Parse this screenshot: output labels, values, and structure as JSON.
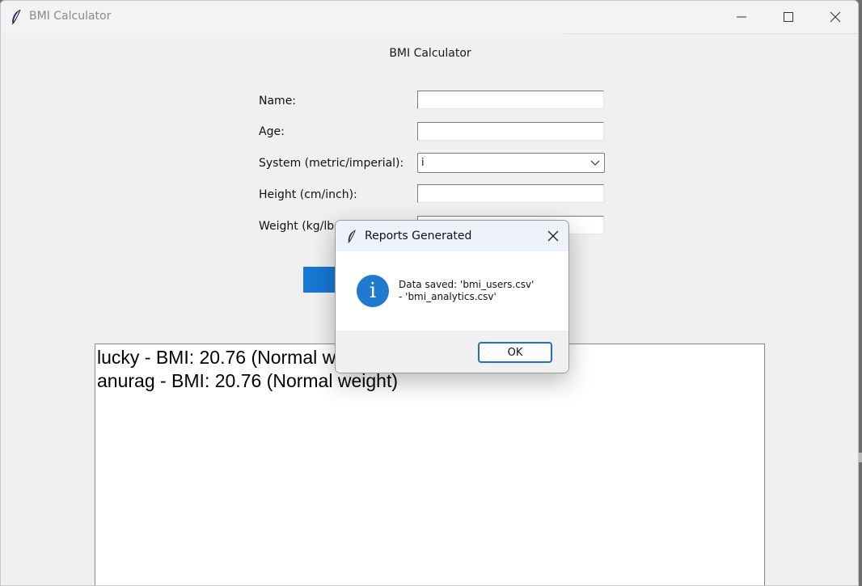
{
  "window": {
    "title": "BMI Calculator"
  },
  "form": {
    "heading": "BMI Calculator",
    "name_label": "Name:",
    "name_value": "",
    "age_label": "Age:",
    "age_value": "",
    "system_label": "System (metric/imperial):",
    "system_value": "i",
    "height_label": "Height (cm/inch):",
    "height_value": "",
    "weight_label": "Weight (kg/lbs):",
    "weight_value": ""
  },
  "results": {
    "lines": [
      "lucky - BMI: 20.76 (Normal weight)",
      "anurag - BMI: 20.76 (Normal weight)"
    ]
  },
  "dialog": {
    "title": "Reports Generated",
    "message": "Data saved: 'bmi_users.csv'\n- 'bmi_analytics.csv'",
    "ok_label": "OK",
    "icon": "info-icon"
  },
  "colors": {
    "accent": "#1778d4",
    "info": "#1f7ad0"
  }
}
